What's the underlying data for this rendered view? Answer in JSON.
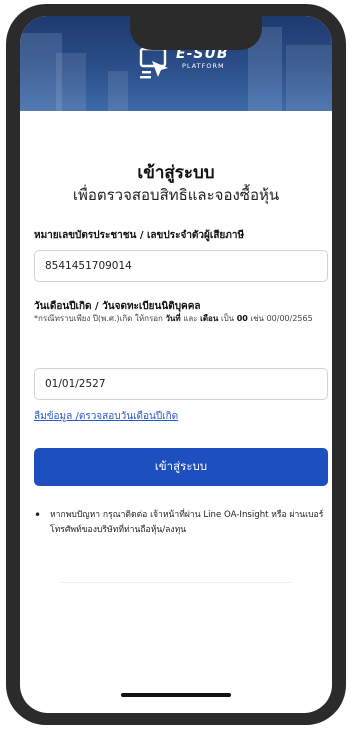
{
  "brand": {
    "name": "E-SUB",
    "tagline": "PLATFORM",
    "colors": {
      "primary": "#1e4fbf",
      "header": "#2b4f8a",
      "link": "#2a58c8"
    }
  },
  "login": {
    "title": "เข้าสู่ระบบ",
    "subtitle": "เพื่อตรวจสอบสิทธิและจองซื้อหุ้น",
    "id_field": {
      "label": "หมายเลขบัตรประชาชน / เลขประจำตัวผู้เสียภาษี",
      "value": "8541451709014"
    },
    "dob_field": {
      "label": "วันเดือนปีเกิด / วันจดทะเบียนนิติบุคคล",
      "hint_parts": [
        "*กรณีทราบเพียง ปี(พ.ศ.)เกิด ให้กรอก ",
        "วันที่",
        " และ ",
        "เดือน",
        " เป็น ",
        "00",
        " เช่น 00/00/2565"
      ],
      "value": "01/01/2527"
    },
    "forgot_link": "ลืมข้อมูล /ตรวจสอบวันเดือนปีเกิด",
    "submit_label": "เข้าสู่ระบบ",
    "note": "หากพบปัญหา กรุณาติดต่อ เจ้าหน้าที่ผ่าน Line OA-Insight หรือ ผ่านเบอร์โทรศัพท์ของบริษัทที่ท่านถือหุ้น/ลงทุน"
  }
}
